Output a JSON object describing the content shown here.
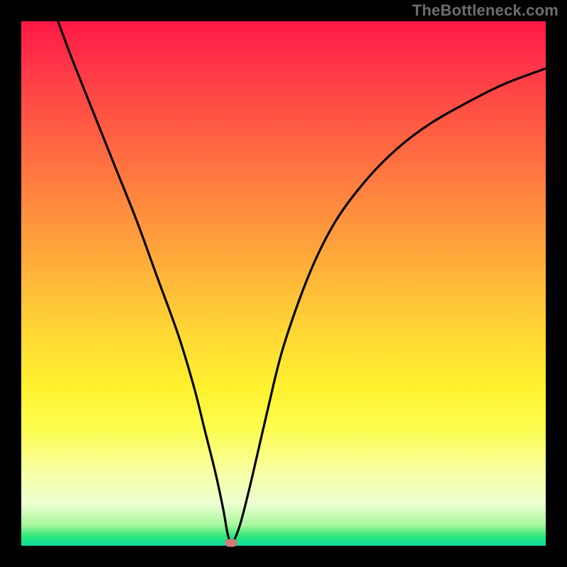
{
  "watermark": "TheBottleneck.com",
  "accent_marker_color": "#d17a7a",
  "curve_color": "#000000",
  "chart_data": {
    "type": "line",
    "title": "",
    "xlabel": "",
    "ylabel": "",
    "xlim": [
      0,
      100
    ],
    "ylim": [
      0,
      100
    ],
    "grid": false,
    "legend": false,
    "series": [
      {
        "name": "bottleneck-curve",
        "x": [
          7,
          10,
          14,
          18,
          22,
          26,
          30,
          33,
          35,
          37,
          38.5,
          39.3,
          40,
          40.8,
          42,
          44,
          47,
          50,
          55,
          60,
          66,
          72,
          78,
          85,
          92,
          100
        ],
        "y": [
          100,
          92,
          82,
          72,
          62,
          51,
          40,
          30,
          22,
          14,
          7,
          2.5,
          0.5,
          1.5,
          5,
          13,
          26,
          38,
          52,
          62,
          70,
          76,
          80.5,
          84.5,
          88,
          91
        ]
      }
    ],
    "marker": {
      "x": 40,
      "y": 0.5
    },
    "gradient_stops": [
      {
        "pos": 0,
        "color": "#ff1846"
      },
      {
        "pos": 70,
        "color": "#fff12e"
      },
      {
        "pos": 98,
        "color": "#2fe67a"
      },
      {
        "pos": 100,
        "color": "#0fd9a0"
      }
    ]
  }
}
